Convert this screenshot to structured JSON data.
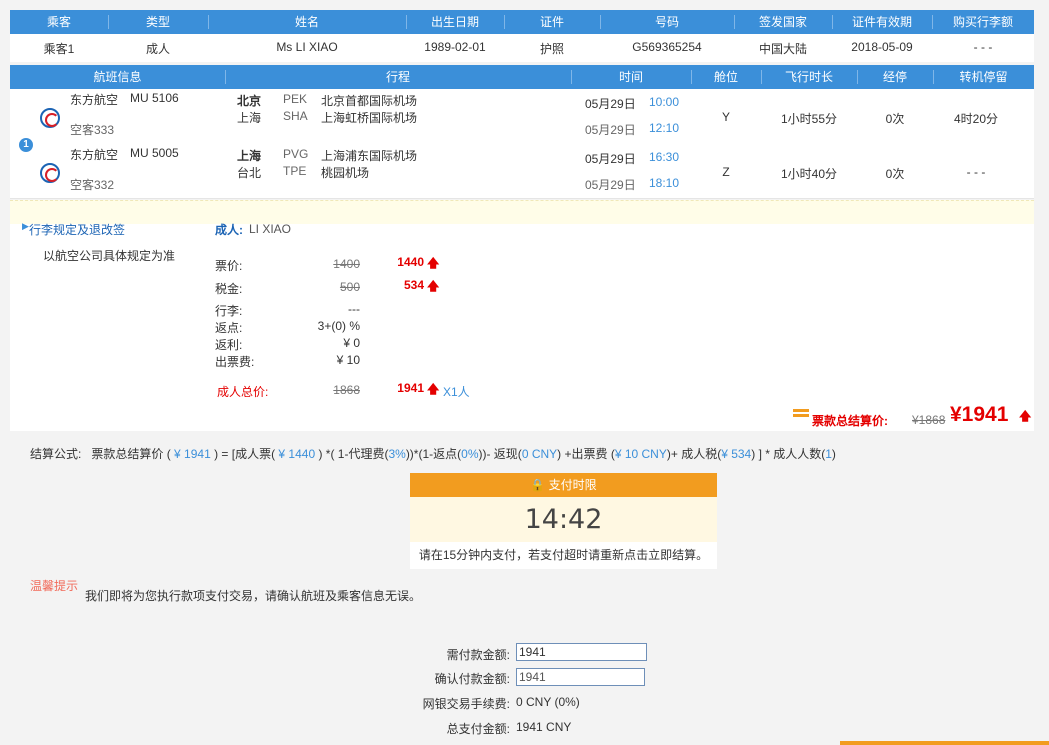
{
  "passenger_table": {
    "headers": [
      "乘客",
      "类型",
      "姓名",
      "出生日期",
      "证件",
      "号码",
      "签发国家",
      "证件有效期",
      "购买行李额"
    ],
    "row": [
      "乘客1",
      "成人",
      "Ms LI XIAO",
      "1989-02-01",
      "护照",
      "G569365254",
      "中国大陆",
      "2018-05-09",
      "- - -"
    ]
  },
  "flight_table": {
    "headers": [
      "航班信息",
      "行程",
      "时间",
      "舱位",
      "飞行时长",
      "经停",
      "转机停留"
    ],
    "segment_badge": "1",
    "flights": [
      {
        "airline": "东方航空",
        "flight_no": "MU 5106",
        "aircraft": "空客333",
        "dep_city": "北京",
        "dep_code": "PEK",
        "dep_airport": "北京首都国际机场",
        "arr_city": "上海",
        "arr_code": "SHA",
        "arr_airport": "上海虹桥国际机场",
        "dep_date": "05月29日",
        "dep_time": "10:00",
        "arr_date": "05月29日",
        "arr_time": "12:10",
        "cabin": "Y",
        "duration": "1小时55分",
        "stops": "0次",
        "transfer": "4时20分"
      },
      {
        "airline": "东方航空",
        "flight_no": "MU 5005",
        "aircraft": "空客332",
        "dep_city": "上海",
        "dep_code": "PVG",
        "dep_airport": "上海浦东国际机场",
        "arr_city": "台北",
        "arr_code": "TPE",
        "arr_airport": "桃园机场",
        "dep_date": "05月29日",
        "dep_time": "16:30",
        "arr_date": "05月29日",
        "arr_time": "18:10",
        "cabin": "Z",
        "duration": "1小时40分",
        "stops": "0次",
        "transfer": "- - -"
      }
    ]
  },
  "rules": {
    "link": "行李规定及退改签",
    "note": "以航空公司具体规定为准"
  },
  "pricing": {
    "passenger_label": "成人:",
    "passenger_name": "LI XIAO",
    "fare_label": "票价:",
    "fare_old": "1400",
    "fare_new": "1440",
    "tax_label": "税金:",
    "tax_old": "500",
    "tax_new": "534",
    "baggage_label": "行李:",
    "baggage_value": "---",
    "rebate_label": "返点:",
    "rebate_value": "3+(0) %",
    "cashback_label": "返利:",
    "cashback_value": "¥ 0",
    "ticket_fee_label": "出票费:",
    "ticket_fee_value": "¥ 10",
    "adult_total_label": "成人总价:",
    "adult_total_old": "1868",
    "adult_total_new": "1941",
    "adult_count": "X1人",
    "settle_label": "票款总结算价:",
    "settle_old": "¥1868",
    "settle_new": "¥1941"
  },
  "formula": {
    "label": "结算公式:",
    "p1": "票款总结算价 (",
    "v1": " ¥ 1941 ",
    "p2": ") = [成人票(",
    "v2": " ¥ 1440 ",
    "p3": ") *( 1-代理费(",
    "v3": "3%",
    "p4": "))*(1-返点(",
    "v4": "0%",
    "p5": "))- 返现(",
    "v5": "0 CNY",
    "p6": ") +出票费 (",
    "v6": "¥ 10 CNY",
    "p7": ")+ 成人税(",
    "v7": "¥ 534",
    "p8": ") ] * 成人人数(",
    "v8": "1",
    "p9": ")"
  },
  "payment_limit": {
    "title": "支付时限",
    "countdown": "14:42",
    "note": "请在15分钟内支付，若支付超时请重新点击立即结算。"
  },
  "tips": {
    "label": "温馨提示",
    "text": "我们即将为您执行款项支付交易，请确认航班及乘客信息无误。"
  },
  "payment": {
    "amount_label": "需付款金额:",
    "amount_value": "1941",
    "confirm_label": "确认付款金额:",
    "confirm_value": "1941",
    "fee_label": "网银交易手续费:",
    "fee_value": "0 CNY (0%)",
    "total_label": "总支付金额:",
    "total_value": "1941 CNY"
  },
  "colors": {
    "header_blue": "#3b8fd9",
    "price_red": "#e40000",
    "limit_orange": "#f29c1f"
  }
}
